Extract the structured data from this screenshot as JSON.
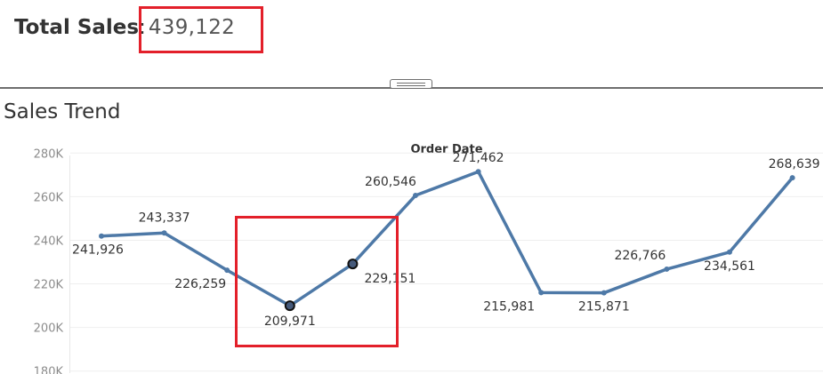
{
  "kpi": {
    "label": "Total Sales",
    "separator": ":",
    "value": "439,122"
  },
  "worksheet": {
    "title": "Sales Trend"
  },
  "chart_data": {
    "type": "line",
    "title": "",
    "xlabel": "Order Date",
    "ylabel": "",
    "ylim": [
      175000,
      285000
    ],
    "yticks": [
      180000,
      200000,
      220000,
      240000,
      260000,
      280000
    ],
    "ytick_labels": [
      "180K",
      "200K",
      "220K",
      "240K",
      "260K",
      "280K"
    ],
    "grid": true,
    "color": "#4e79a7",
    "series": [
      {
        "values": [
          241926,
          243337,
          226259,
          209971,
          229151,
          260546,
          271462,
          215981,
          215871,
          226766,
          234561,
          268639
        ],
        "labels": [
          "241,926",
          "243,337",
          "226,259",
          "209,971",
          "229,151",
          "260,546",
          "271,462",
          "215,981",
          "215,871",
          "226,766",
          "234,561",
          "268,639"
        ]
      }
    ],
    "highlighted_points": [
      3,
      4
    ]
  }
}
